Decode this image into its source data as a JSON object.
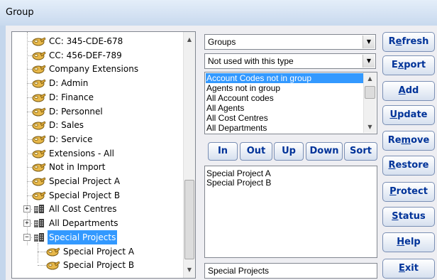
{
  "window": {
    "title": "Group"
  },
  "tree": {
    "items": [
      {
        "label": "CC: 345-CDE-678",
        "icon": "key-icon"
      },
      {
        "label": "CC: 456-DEF-789",
        "icon": "key-icon"
      },
      {
        "label": "Company Extensions",
        "icon": "key-icon"
      },
      {
        "label": "D: Admin",
        "icon": "key-icon"
      },
      {
        "label": "D: Finance",
        "icon": "key-icon"
      },
      {
        "label": "D: Personnel",
        "icon": "key-icon"
      },
      {
        "label": "D: Sales",
        "icon": "key-icon"
      },
      {
        "label": "D: Service",
        "icon": "key-icon"
      },
      {
        "label": "Extensions - All",
        "icon": "key-icon"
      },
      {
        "label": "Not in Import",
        "icon": "key-icon"
      },
      {
        "label": "Special Project A",
        "icon": "key-icon"
      },
      {
        "label": "Special Project B",
        "icon": "key-icon"
      },
      {
        "label": "All Cost Centres",
        "icon": "building-icon",
        "expander": "+"
      },
      {
        "label": "All Departments",
        "icon": "building-icon",
        "expander": "+"
      },
      {
        "label": "Special Projects",
        "icon": "building-icon",
        "expander": "−",
        "selected": true
      },
      {
        "label": "Special Project A",
        "icon": "key-icon",
        "child": true
      },
      {
        "label": "Special Project B",
        "icon": "key-icon",
        "child": true
      }
    ]
  },
  "combo_type": {
    "value": "Groups"
  },
  "combo_filter": {
    "value": "Not used with this type"
  },
  "available_list": {
    "items": [
      "Account Codes not in group",
      "Agents not in group",
      "All Account codes",
      "All Agents",
      "All Cost Centres",
      "All Departments"
    ],
    "selected_index": 0
  },
  "move_buttons": {
    "in": "In",
    "out": "Out",
    "up": "Up",
    "down": "Down",
    "sort": "Sort"
  },
  "members_list": {
    "items": [
      "Special Project A",
      "Special Project B"
    ]
  },
  "group_name": {
    "value": "Special Projects"
  },
  "actions": {
    "refresh": {
      "pre": "R",
      "key": "e",
      "post": "fresh"
    },
    "export": {
      "pre": "E",
      "key": "x",
      "post": "port"
    },
    "add": {
      "pre": "",
      "key": "A",
      "post": "dd"
    },
    "update": {
      "pre": "",
      "key": "U",
      "post": "pdate"
    },
    "remove": {
      "pre": "Re",
      "key": "m",
      "post": "ove"
    },
    "restore": {
      "pre": "",
      "key": "R",
      "post": "estore"
    },
    "protect": {
      "pre": "",
      "key": "P",
      "post": "rotect"
    },
    "status": {
      "pre": "",
      "key": "S",
      "post": "tatus"
    },
    "help": {
      "pre": "",
      "key": "H",
      "post": "elp"
    },
    "exit": {
      "pre": "",
      "key": "E",
      "post": "xit"
    }
  },
  "colors": {
    "selection": "#3399ff",
    "button_text": "#003399",
    "window_frame": "#c4d6ec"
  }
}
